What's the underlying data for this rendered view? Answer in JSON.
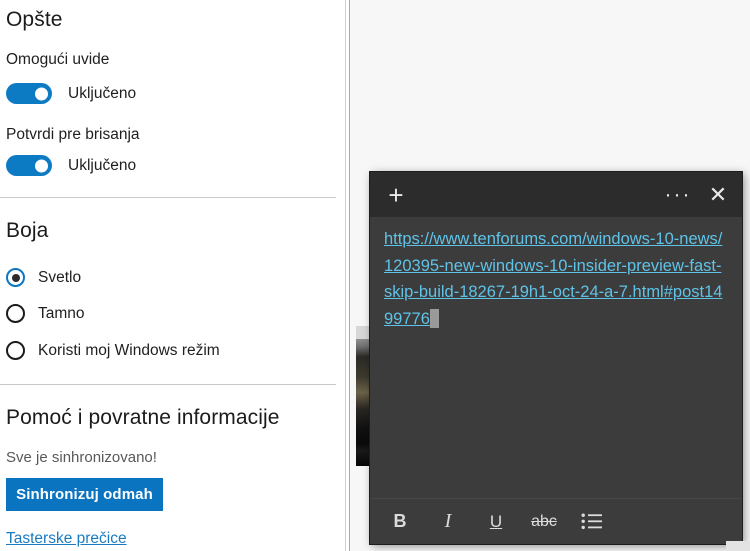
{
  "settings_pane": {
    "sections": [
      {
        "id": "general",
        "title": "Opšte",
        "items": [
          {
            "label": "Omogući uvide",
            "toggle_state_label": "Uključeno",
            "toggle_on": true
          },
          {
            "label": "Potvrdi pre brisanja",
            "toggle_state_label": "Uključeno",
            "toggle_on": true
          }
        ]
      },
      {
        "id": "color",
        "title": "Boja",
        "options": [
          {
            "label": "Svetlo",
            "selected": true
          },
          {
            "label": "Tamno",
            "selected": false
          },
          {
            "label": "Koristi moj Windows režim",
            "selected": false
          }
        ]
      },
      {
        "id": "help",
        "title": "Pomoć i povratne informacije",
        "status_text": "Sve je sinhronizovano!",
        "sync_button_label": "Sinhronizuj odmah",
        "shortcuts_link_label": "Tasterske prečice"
      }
    ]
  },
  "sticky_note": {
    "header": {
      "add_icon": "+",
      "more_icon": "···",
      "close_icon": "✕"
    },
    "body": {
      "link_text": "https://www.tenforums.com/windows-10-news/120395-new-windows-10-insider-preview-fast-skip-build-18267-19h1-oct-24-a-7.html#post1499776"
    },
    "toolbar": {
      "bold_label": "B",
      "italic_label": "I",
      "underline_label": "U",
      "strikethrough_label": "abc",
      "bullets_label": "☰"
    }
  },
  "colors": {
    "accent_blue": "#0a74c0",
    "toggle_blue": "#0d7ac4",
    "link_blue": "#1a7bc0",
    "note_link_blue": "#5fc3e8",
    "note_body_bg": "#3c3c3c",
    "note_header_bg": "#2c2c2c"
  }
}
